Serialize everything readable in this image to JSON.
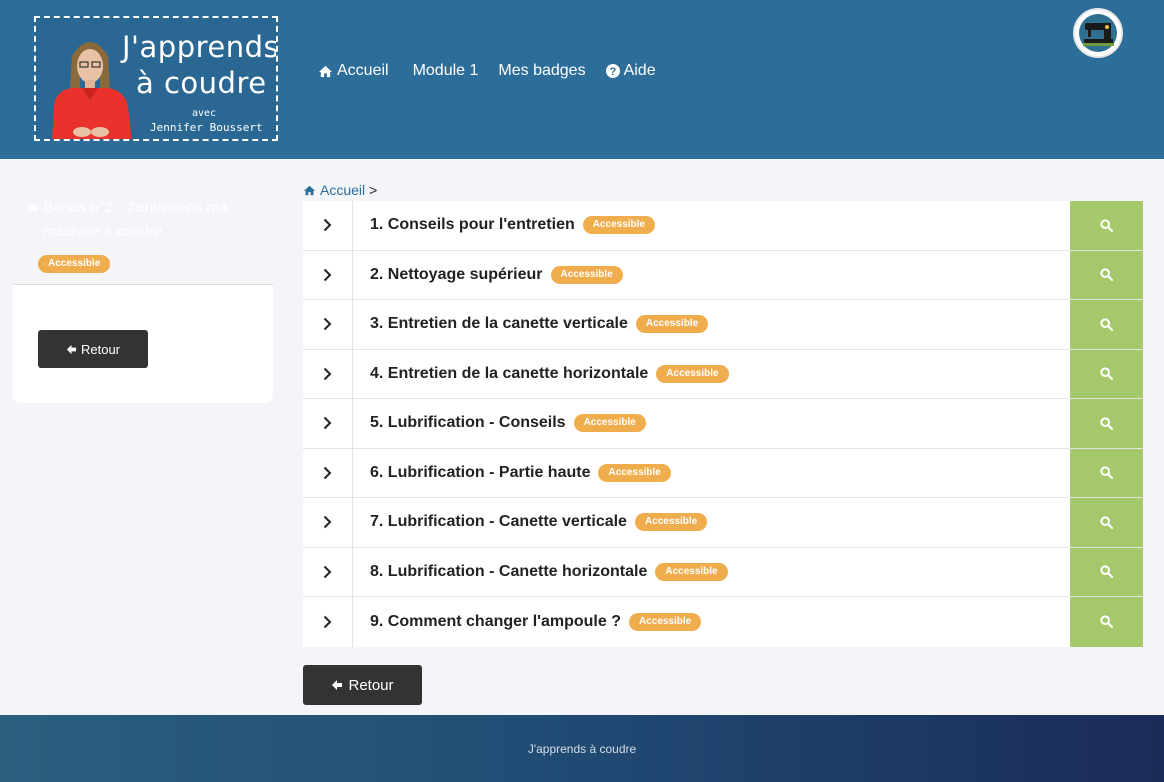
{
  "brand": {
    "title_line1": "J'apprends",
    "title_line2": "à coudre",
    "avec": "avec",
    "author": "Jennifer Boussert"
  },
  "nav": {
    "home": "Accueil",
    "module": "Module 1",
    "badges": "Mes badges",
    "help": "Aide"
  },
  "sidebar": {
    "title": "Bonus n°2 - J'entretiens ma machine à coudre",
    "badge": "Accessible",
    "back_label": "Retour"
  },
  "breadcrumb": {
    "home": "Accueil",
    "separator": ">"
  },
  "lessons": [
    {
      "title": "1. Conseils pour l'entretien",
      "status": "Accessible"
    },
    {
      "title": "2. Nettoyage supérieur",
      "status": "Accessible"
    },
    {
      "title": "3. Entretien de la canette verticale",
      "status": "Accessible"
    },
    {
      "title": "4. Entretien de la canette horizontale",
      "status": "Accessible"
    },
    {
      "title": "5. Lubrification - Conseils",
      "status": "Accessible"
    },
    {
      "title": "6. Lubrification - Partie haute",
      "status": "Accessible"
    },
    {
      "title": "7. Lubrification - Canette verticale",
      "status": "Accessible"
    },
    {
      "title": "8. Lubrification - Canette horizontale",
      "status": "Accessible"
    },
    {
      "title": "9. Comment changer l'ampoule ?",
      "status": "Accessible"
    }
  ],
  "main": {
    "back_label": "Retour"
  },
  "footer": {
    "text": "J'apprends à coudre"
  },
  "colors": {
    "header": "#2d6d99",
    "badge": "#f0ad4e",
    "search_cell": "#a5c96a",
    "button": "#333333"
  }
}
